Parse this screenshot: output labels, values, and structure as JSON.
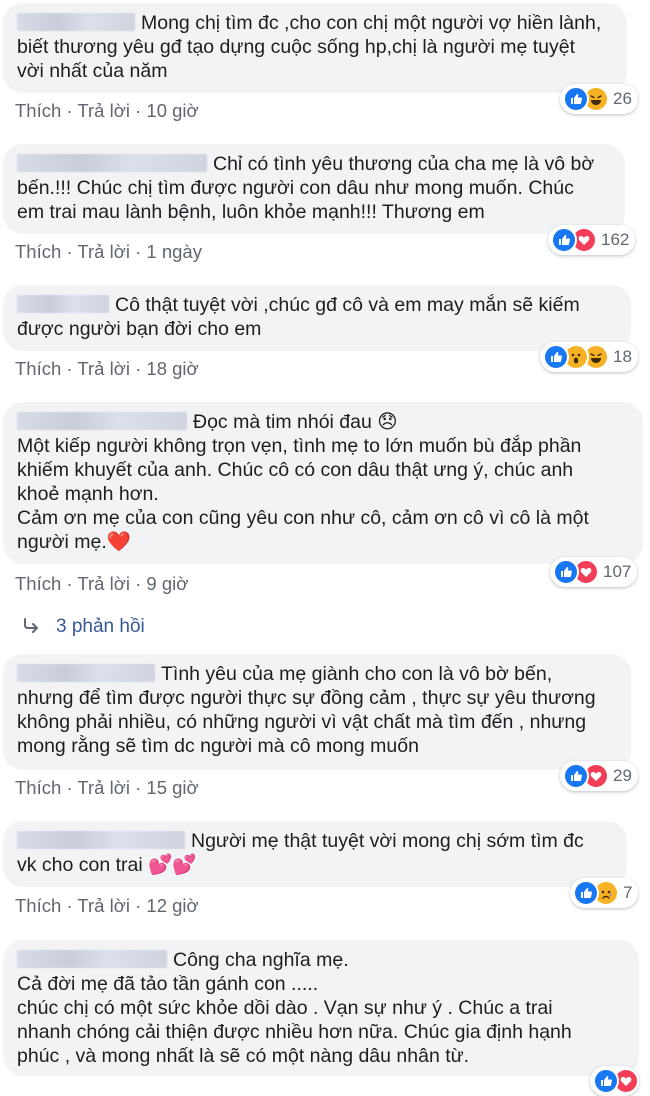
{
  "actions": {
    "like": "Thích",
    "reply": "Trả lời",
    "sep": " · "
  },
  "comments": [
    {
      "lines": [
        "Mong chị tìm đc ,cho con chị một người vợ hiền lành,",
        "biết thương yêu gđ tạo dựng cuộc sống hp,chị là người mẹ tuyệt",
        "vời nhất của năm"
      ],
      "time": "10 giờ",
      "count": "26",
      "reactions": [
        "like-icon",
        "haha-icon"
      ]
    },
    {
      "lines": [
        "Chỉ có tình yêu thương của cha mẹ là vô bờ",
        "bến.!!! Chúc chị tìm được người con dâu như mong muốn. Chúc",
        "em trai mau lành bệnh, luôn khỏe mạnh!!! Thương em"
      ],
      "time": "1 ngày",
      "count": "162",
      "reactions": [
        "like-icon",
        "love-icon"
      ]
    },
    {
      "lines": [
        "Cô thật tuyệt vời ,chúc gđ cô và em may mắn sẽ kiếm",
        "được người bạn đời cho em"
      ],
      "time": "18 giờ",
      "count": "18",
      "reactions": [
        "like-icon",
        "wow-icon",
        "haha-icon"
      ]
    },
    {
      "lines": [
        "Đọc mà tim nhói đau 😞",
        "Một kiếp người không trọn vẹn, tình mẹ to lớn muốn bù đắp phần",
        "khiếm khuyết của anh. Chúc cô có con dâu thật ưng ý, chúc anh",
        "khoẻ mạnh hơn.",
        "Cảm ơn mẹ của con cũng yêu con như cô, cảm ơn cô vì cô là một",
        "người mẹ.❤️"
      ],
      "time": "9 giờ",
      "count": "107",
      "reactions": [
        "like-icon",
        "love-icon"
      ]
    },
    {
      "lines": [
        "Tình yêu của mẹ giành cho con là vô bờ bến,",
        "nhưng để tìm được người thực sự đồng cảm , thực sự yêu thương",
        "không phải nhiều, có những người vì vật chất mà tìm đến , nhưng",
        "mong rằng sẽ tìm dc người mà cô mong muốn"
      ],
      "time": "15 giờ",
      "count": "29",
      "reactions": [
        "like-icon",
        "love-icon"
      ]
    },
    {
      "lines": [
        "Người mẹ thật tuyệt vời mong chị sớm tìm đc",
        "vk cho con trai 💕💕"
      ],
      "time": "12 giờ",
      "count": "7",
      "reactions": [
        "like-icon",
        "sad-icon"
      ]
    },
    {
      "lines": [
        "Công cha nghĩa mẹ.",
        "Cả đời mẹ đã tảo tần gánh con .....",
        "chúc chị có một sức khỏe dồi dào . Vạn sự như ý . Chúc a trai",
        "nhanh chóng cải thiện được nhiều hơn nữa. Chúc gia định hạnh",
        "phúc , và mong nhất là sẽ có một nàng dâu nhân từ."
      ],
      "time": "",
      "count": "",
      "reactions": [
        "like-icon",
        "love-icon"
      ]
    }
  ],
  "replies": {
    "label": "3 phản hồi"
  },
  "colors": {
    "like": "#1877f2",
    "love": "#f33e58",
    "yellow": "#f7b125",
    "link": "#385898"
  }
}
